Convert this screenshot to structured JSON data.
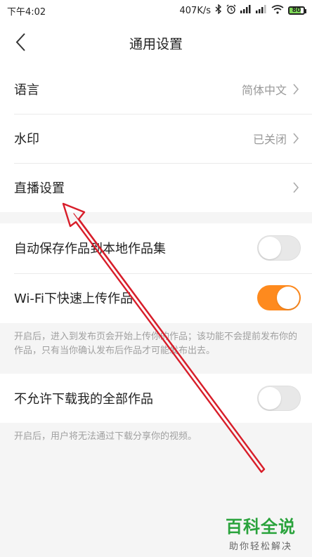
{
  "status_bar": {
    "time": "下午4:02",
    "network_speed": "407K/s",
    "battery": "80",
    "battery_level": 0.8
  },
  "header": {
    "title": "通用设置"
  },
  "group1": {
    "items": [
      {
        "label": "语言",
        "value": "简体中文"
      },
      {
        "label": "水印",
        "value": "已关闭"
      },
      {
        "label": "直播设置",
        "value": ""
      }
    ]
  },
  "group2": {
    "items": [
      {
        "label": "自动保存作品到本地作品集",
        "enabled": false
      },
      {
        "label": "Wi-Fi下快速上传作品",
        "enabled": true
      }
    ],
    "note": "开启后，进入到发布页会开始上传你的作品；该功能不会提前发布你的作品，只有当你确认发布后作品才可能发布出去。"
  },
  "group3": {
    "items": [
      {
        "label": "不允许下载我的全部作品",
        "enabled": false
      }
    ],
    "note": "开启后，用户将无法通过下载分享你的视频。"
  },
  "colors": {
    "accent": "#fe8a1e",
    "annotation": "#d81e2a",
    "watermark": "#2aa33c"
  },
  "watermark": {
    "main": "百科全说",
    "sub": "助你轻松解决"
  }
}
